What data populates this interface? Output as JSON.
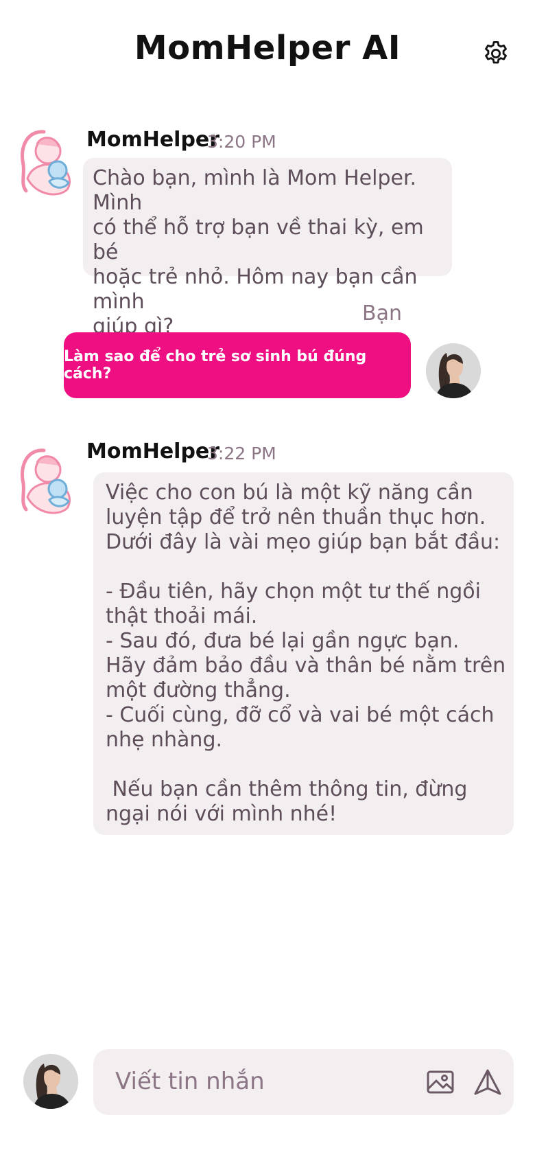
{
  "header": {
    "title": "MomHelper AI",
    "settings_icon": "gear-icon"
  },
  "messages": [
    {
      "role": "bot",
      "sender": "MomHelper",
      "time": "3:20 PM",
      "text": "Chào bạn, mình là Mom Helper. Mình\ncó thể hỗ trợ bạn về thai kỳ, em bé\nhoặc trẻ nhỏ. Hôm nay bạn cần mình\ngiúp gì?"
    },
    {
      "role": "user",
      "sender": "Bạn",
      "text": "Làm sao để cho trẻ sơ sinh bú đúng cách?"
    },
    {
      "role": "bot",
      "sender": "MomHelper",
      "time": "3:22 PM",
      "text": "Việc cho con bú là một kỹ năng cần\nluyện tập để trở nên thuần thục hơn.\nDưới đây là vài mẹo giúp bạn bắt đầu:\n\n- Đầu tiên, hãy chọn một tư thế ngồi\nthật thoải mái.\n- Sau đó, đưa bé lại gần ngực bạn.\nHãy đảm bảo đầu và thân bé nằm trên\nmột đường thẳng.\n- Cuối cùng, đỡ cổ và vai bé một cách\nnhẹ nhàng.\n\n Nếu bạn cần thêm thông tin, đừng\nngại nói với mình nhé!"
    }
  ],
  "composer": {
    "placeholder": "Viết tin nhắn",
    "value": "",
    "image_icon": "image-icon",
    "send_icon": "send-icon"
  },
  "colors": {
    "accent": "#ee0f83",
    "bubble_bg": "#f3eff1",
    "muted_text": "#8c7585",
    "bubble_text": "#5e4e5a"
  }
}
